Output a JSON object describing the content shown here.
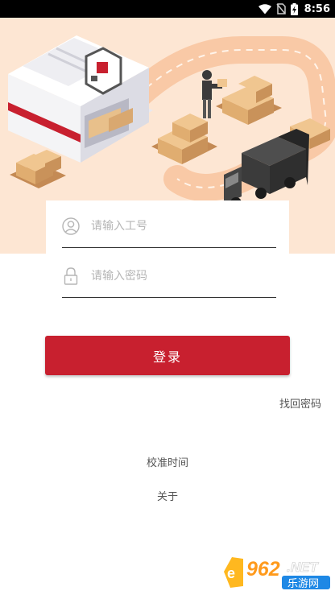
{
  "status_bar": {
    "time": "8:56"
  },
  "login": {
    "employee_id_placeholder": "请输入工号",
    "employee_id_value": "",
    "password_placeholder": "请输入密码",
    "password_value": "",
    "submit_label": "登录"
  },
  "links": {
    "forgot_password": "找回密码",
    "calibrate_time": "校准时间",
    "about": "关于"
  },
  "watermark": {
    "brand_number": "962",
    "brand_suffix": ".NET",
    "brand_name": "乐游网"
  },
  "colors": {
    "accent": "#c8202f",
    "hero_bg": "#fde6d3",
    "road": "#f9c9a6"
  }
}
